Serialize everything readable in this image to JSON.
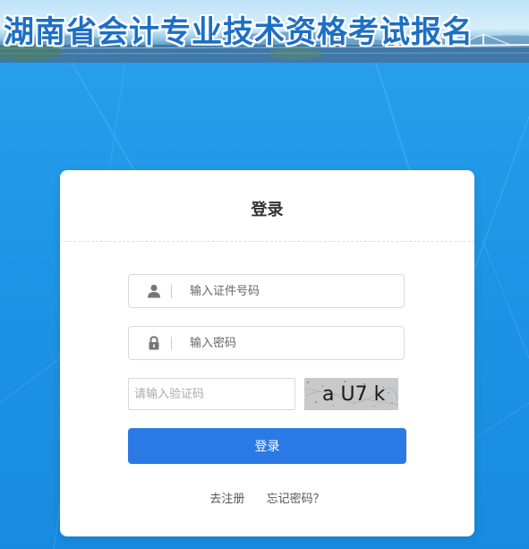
{
  "banner": {
    "title": "湖南省会计专业技术资格考试报名"
  },
  "login": {
    "title": "登录",
    "id_placeholder": "输入证件号码",
    "password_placeholder": "输入密码",
    "captcha_placeholder": "请输入验证码",
    "captcha_text": "a U7 k",
    "submit_label": "登录",
    "register_link": "去注册",
    "forgot_link": "忘记密码？"
  },
  "colors": {
    "page_background": "#1f95e6",
    "primary_button": "#2b79e4",
    "banner_title": "#1d6fc4"
  },
  "icons": {
    "id_field": "user-icon",
    "password_field": "lock-icon"
  }
}
